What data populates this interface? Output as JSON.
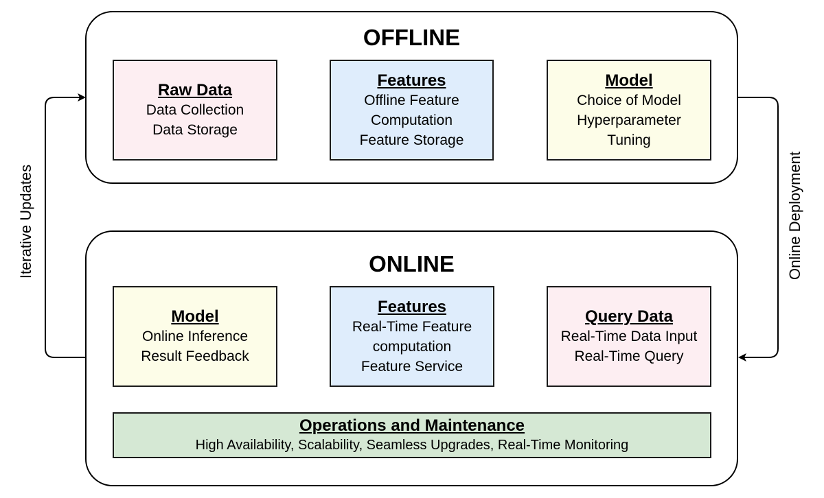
{
  "offline": {
    "title": "OFFLINE",
    "boxes": [
      {
        "head": "Raw Data",
        "lines": [
          "Data Collection",
          "Data Storage"
        ],
        "color": "#fdeef2"
      },
      {
        "head": "Features",
        "lines": [
          "Offline Feature",
          "Computation",
          "Feature Storage"
        ],
        "color": "#dfedfc"
      },
      {
        "head": "Model",
        "lines": [
          "Choice of Model",
          "Hyperparameter",
          "Tuning"
        ],
        "color": "#fdfde8"
      }
    ]
  },
  "online": {
    "title": "ONLINE",
    "boxes": [
      {
        "head": "Model",
        "lines": [
          "Online Inference",
          "Result Feedback"
        ],
        "color": "#fdfde8"
      },
      {
        "head": "Features",
        "lines": [
          "Real-Time Feature",
          "computation",
          "Feature Service"
        ],
        "color": "#dfedfc"
      },
      {
        "head": "Query Data",
        "lines": [
          "Real-Time Data Input",
          "Real-Time Query"
        ],
        "color": "#fdeef2"
      }
    ],
    "operations": {
      "head": "Operations and Maintenance",
      "line": "High Availability, Scalability, Seamless Upgrades, Real-Time Monitoring",
      "color": "#d5e8d4"
    }
  },
  "connectors": {
    "left_label": "Iterative Updates",
    "right_label": "Online Deployment"
  }
}
